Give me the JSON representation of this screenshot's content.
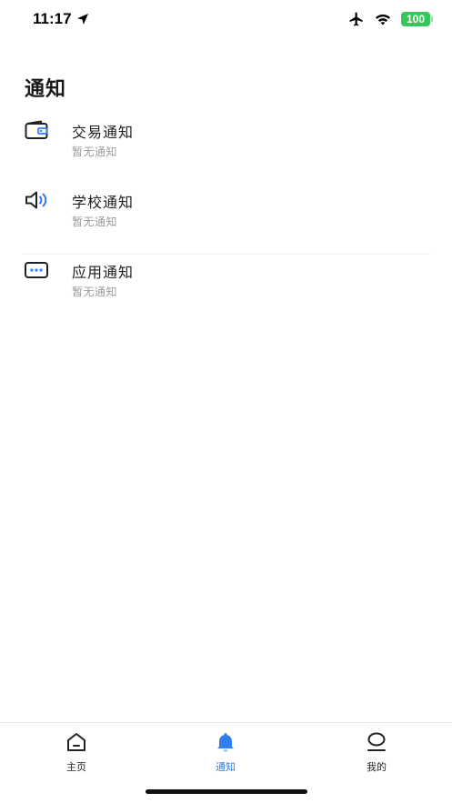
{
  "status_bar": {
    "time": "11:17",
    "battery": "100"
  },
  "page": {
    "title": "通知"
  },
  "notifications": [
    {
      "title": "交易通知",
      "subtitle": "暂无通知",
      "icon": "wallet-icon"
    },
    {
      "title": "学校通知",
      "subtitle": "暂无通知",
      "icon": "speaker-icon"
    },
    {
      "title": "应用通知",
      "subtitle": "暂无通知",
      "icon": "message-dots-icon"
    }
  ],
  "tab_bar": {
    "tabs": [
      {
        "label": "主页",
        "icon": "home-icon",
        "active": false
      },
      {
        "label": "通知",
        "icon": "bell-icon",
        "active": true
      },
      {
        "label": "我的",
        "icon": "profile-icon",
        "active": false
      }
    ]
  },
  "colors": {
    "accent": "#2f7ff0",
    "battery": "#34c759",
    "subtitle": "#9b9b9b"
  }
}
